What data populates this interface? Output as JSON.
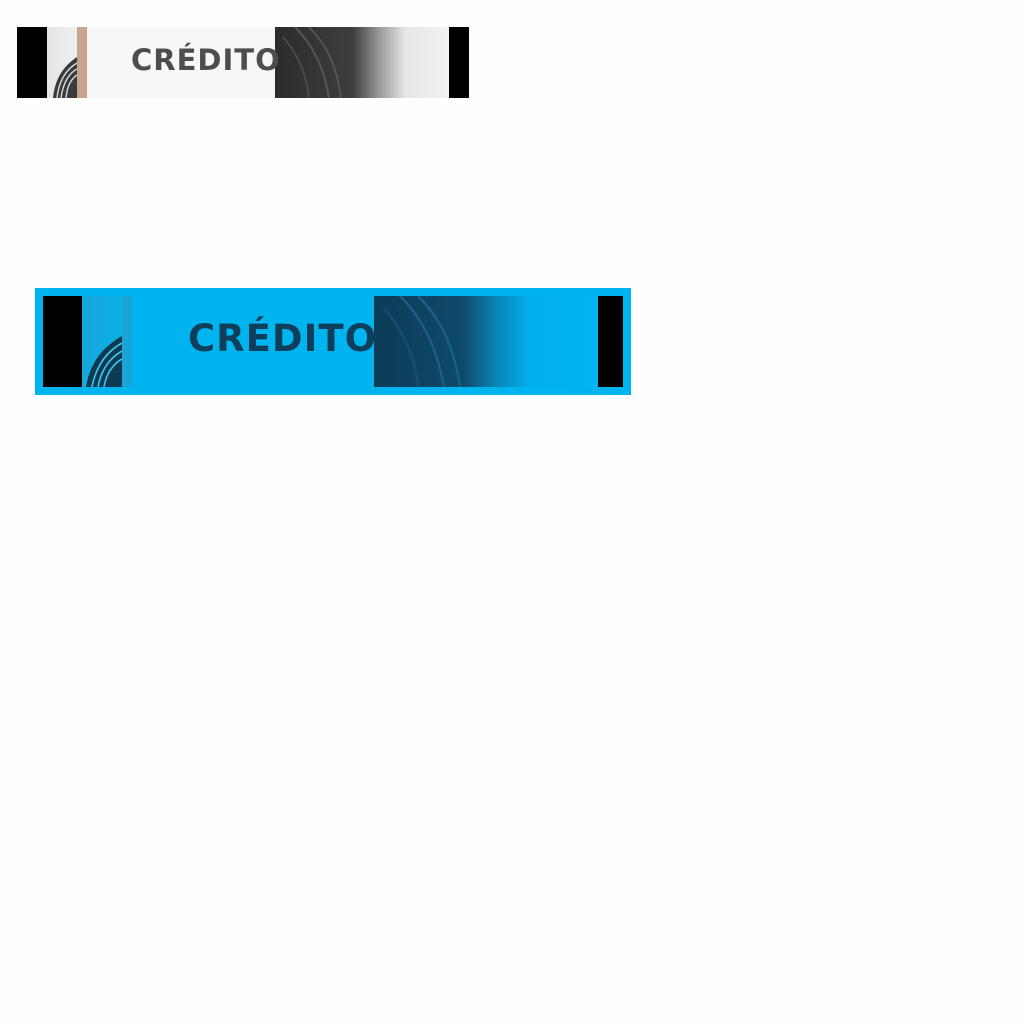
{
  "banners": [
    {
      "state": "normal",
      "label": "CRÉDITO",
      "text_color": "#4d4d4d",
      "background_color": "#f7f7f7",
      "border_color": "#000000"
    },
    {
      "state": "hover",
      "label": "CRÉDITO",
      "text_color": "#0d3f5b",
      "background_color": "#00b4f0",
      "border_color": "#00b4ef"
    }
  ]
}
